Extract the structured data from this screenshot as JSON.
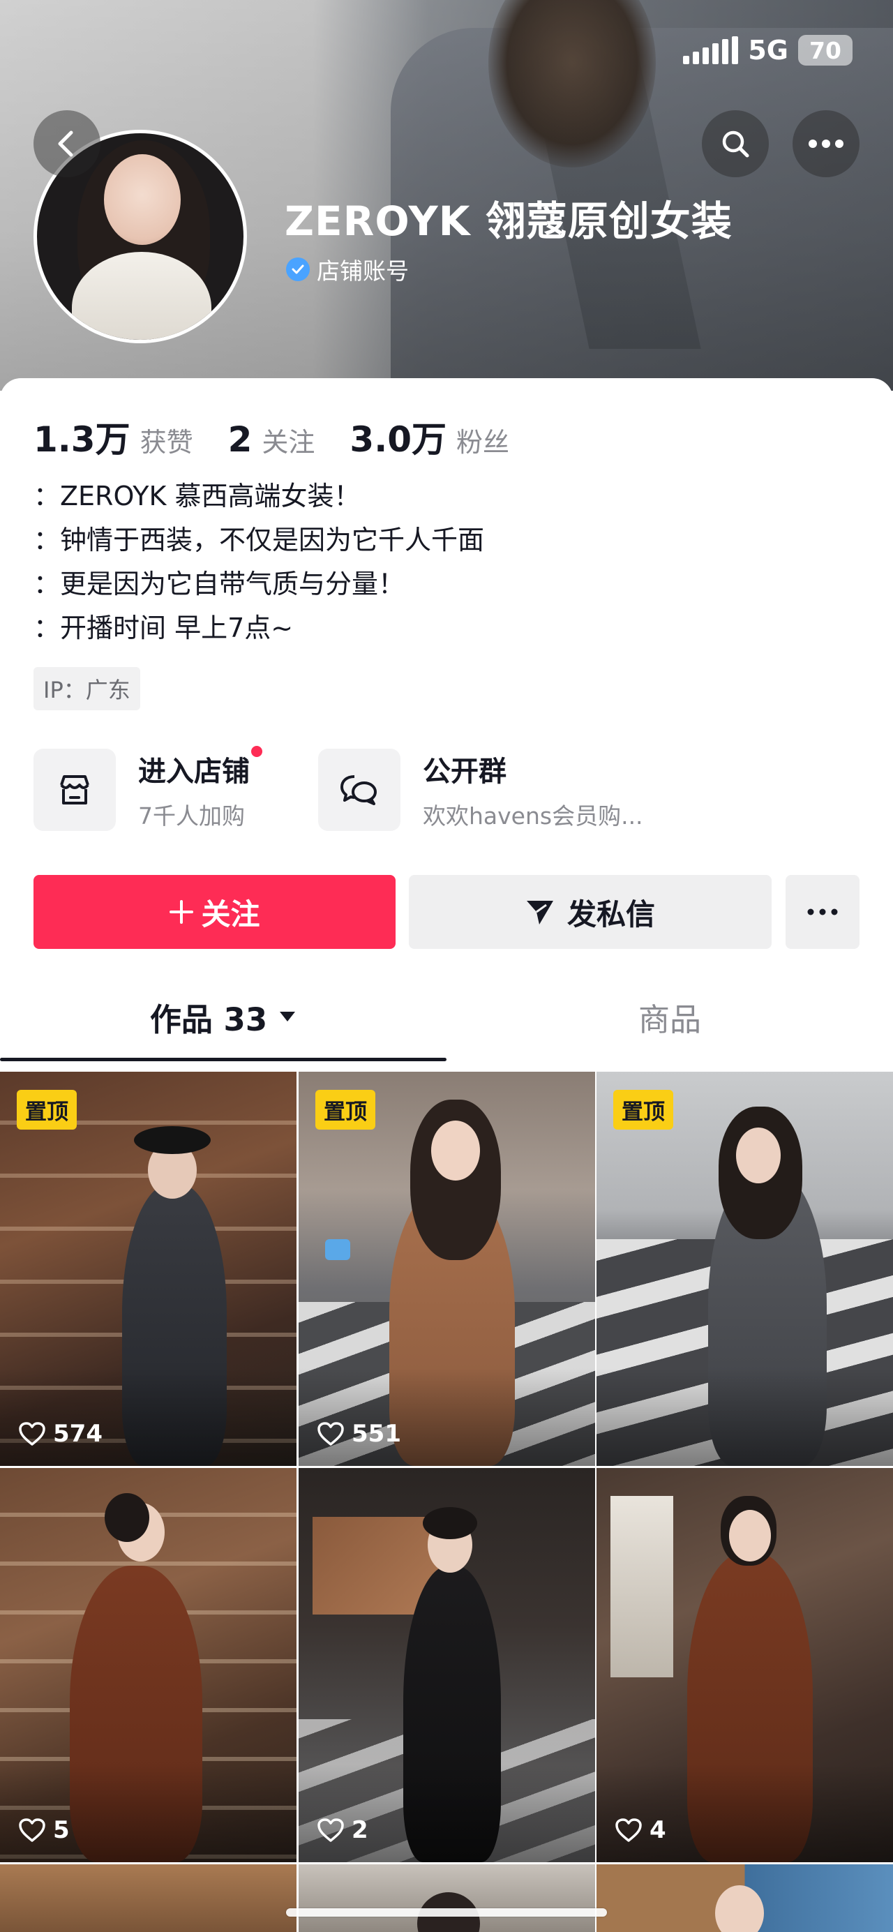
{
  "status_bar": {
    "network": "5G",
    "battery": "70"
  },
  "profile": {
    "name": "ZEROYK 翎蔻原创女装",
    "verified_label": "店铺账号"
  },
  "stats": [
    {
      "value": "1.3万",
      "label": "获赞"
    },
    {
      "value": "2",
      "label": "关注"
    },
    {
      "value": "3.0万",
      "label": "粉丝"
    }
  ],
  "bio": [
    "：ZEROYK 慕西高端女装！",
    "：钟情于西装，不仅是因为它千人千面",
    "：更是因为它自带气质与分量！",
    "：开播时间 早上7点~"
  ],
  "ip_label": "IP：广东",
  "shop_entry": {
    "title": "进入店铺",
    "subtitle": "7千人加购"
  },
  "group_entry": {
    "title": "公开群",
    "subtitle": "欢欢havens会员购..."
  },
  "actions": {
    "follow": "关注",
    "message": "发私信"
  },
  "tabs": {
    "works": "作品 33",
    "products": "商品"
  },
  "colors": {
    "accent": "#fe2c55",
    "pin_badge": "#face15"
  },
  "videos": [
    {
      "pinned": true,
      "pin_label": "置顶",
      "likes": "574"
    },
    {
      "pinned": true,
      "pin_label": "置顶",
      "likes": "551"
    },
    {
      "pinned": true,
      "pin_label": "置顶",
      "likes": ""
    },
    {
      "pinned": false,
      "pin_label": "",
      "likes": "5"
    },
    {
      "pinned": false,
      "pin_label": "",
      "likes": "2"
    },
    {
      "pinned": false,
      "pin_label": "",
      "likes": "4"
    }
  ]
}
